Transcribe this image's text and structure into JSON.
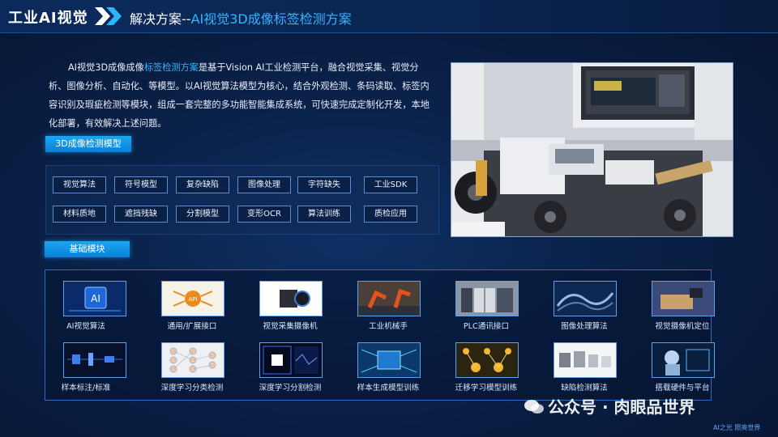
{
  "header": {
    "brand": "工业AI视觉",
    "title_prefix": "解决方案--",
    "title_highlight": "AI视觉3D成像标签检测方案"
  },
  "intro": {
    "lead": "AI视觉3D成像成像",
    "highlight": "标签检测方案",
    "body": "是基于Vision AI工业检测平台，融合视觉采集、视觉分析、图像分析、自动化、等模型。以AI视觉算法模型为核心，结合外观检测、条码读取、标签内容识别及瑕疵检测等模块，组成一套完整的多功能智能集成系统，可快速完成定制化开发，本地化部署，有效解决上述问题。"
  },
  "model_section": {
    "label": "3D成像检测模型",
    "tags_row1": [
      "视觉算法",
      "符号模型",
      "复杂缺陷",
      "图像处理",
      "字符缺失",
      "工业SDK"
    ],
    "tags_row2": [
      "材料质地",
      "遮挡残缺",
      "分割模型",
      "变形OCR",
      "算法训练",
      "质检应用"
    ]
  },
  "basic_section": {
    "label": "基础模块",
    "row1": [
      {
        "label": "AI视觉算法",
        "icon": "ai-chip-icon"
      },
      {
        "label": "通用/扩展接口",
        "icon": "api-interface-icon"
      },
      {
        "label": "视觉采集摄像机",
        "icon": "industrial-camera-icon"
      },
      {
        "label": "工业机械手",
        "icon": "robot-arm-icon"
      },
      {
        "label": "PLC通讯接口",
        "icon": "plc-controller-icon"
      },
      {
        "label": "图像处理算法",
        "icon": "image-processing-icon"
      },
      {
        "label": "视觉摄像机定位",
        "icon": "camera-positioning-icon"
      }
    ],
    "row2": [
      {
        "label": "样本标注/标准",
        "icon": "sample-annotation-icon"
      },
      {
        "label": "深度学习分类检测",
        "icon": "neural-network-icon"
      },
      {
        "label": "深度学习分割检测",
        "icon": "segmentation-chip-icon"
      },
      {
        "label": "样本生成模型训练",
        "icon": "model-training-icon"
      },
      {
        "label": "迁移学习模型训练",
        "icon": "transfer-learning-icon"
      },
      {
        "label": "缺陷检测算法",
        "icon": "defect-detection-icon"
      },
      {
        "label": "搭载硬件与平台",
        "icon": "hardware-platform-icon"
      }
    ]
  },
  "watermark": {
    "text": "公众号 · 肉眼品世界",
    "sub": "AI之光  照亮世界"
  },
  "colors": {
    "accent": "#2fb7ff",
    "background": "#071a36",
    "panel_border": "#2c6cc0"
  }
}
